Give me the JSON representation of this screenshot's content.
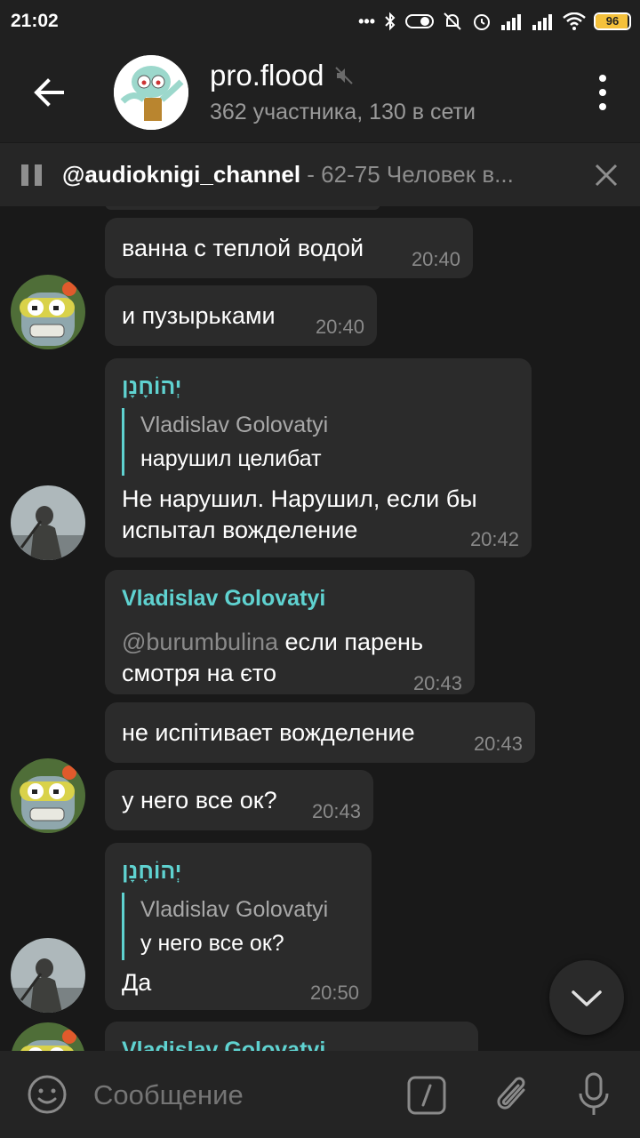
{
  "status_bar": {
    "time": "21:02",
    "battery": "96"
  },
  "header": {
    "title": "pro.flood",
    "subtitle": "362 участника, 130 в сети"
  },
  "pinned_audio": {
    "channel": "@audioknigi_channel",
    "track": " - 62-75 Человек в..."
  },
  "messages": [
    {
      "text": "ванна с теплой водой",
      "time": "20:40"
    },
    {
      "text": "и пузырьками",
      "time": "20:40"
    },
    {
      "sender": "יְהוֹחָנָן",
      "reply_name": "Vladislav Golovatyi",
      "reply_text": "нарушил целибат",
      "lines": [
        "Не нарушил. Нарушил, если бы",
        "испытал вожделение"
      ],
      "time": "20:42"
    },
    {
      "sender": "Vladislav Golovatyi",
      "mention": "@burumbulina",
      "lines": [
        " если парень",
        "смотря на єто"
      ],
      "time": "20:43"
    },
    {
      "text": "не испітивает вожделение",
      "time": "20:43"
    },
    {
      "text": "у него все ок?",
      "time": "20:43"
    },
    {
      "sender": "יְהוֹחָנָן",
      "reply_name": "Vladislav Golovatyi",
      "reply_text": "у него все ок?",
      "text": "Да",
      "time": "20:50"
    },
    {
      "sender": "Vladislav Golovatyi"
    }
  ],
  "composer": {
    "placeholder": "Сообщение"
  },
  "colors": {
    "accent": "#5fd2d0",
    "bubble": "#2b2b2b",
    "background": "#191919"
  }
}
